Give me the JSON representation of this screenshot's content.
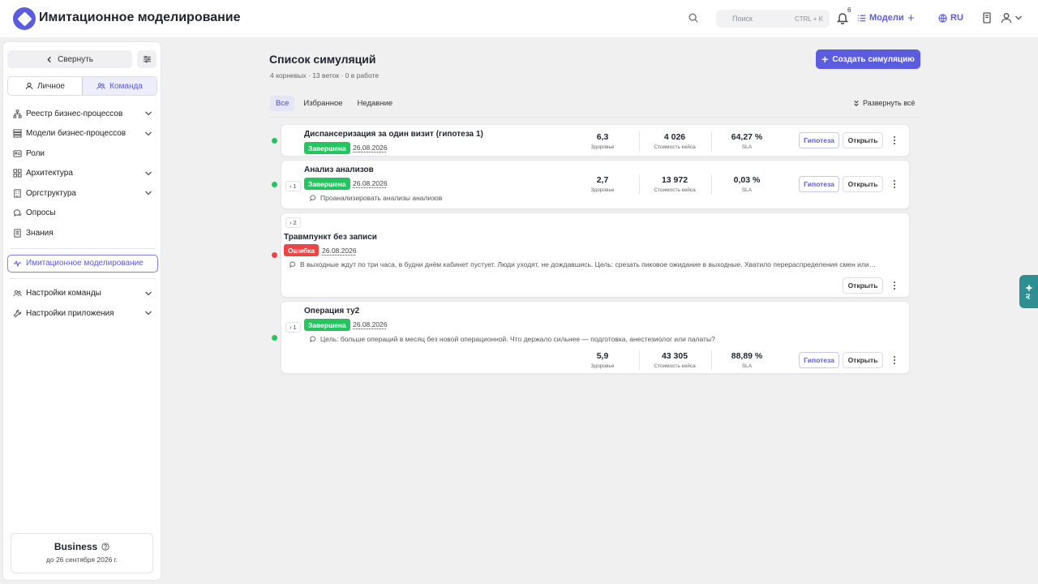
{
  "header": {
    "app_title": "Имитационное моделирование",
    "search_placeholder": "Поиск",
    "search_shortcut": "CTRL + K",
    "notifications_count": "6",
    "models_label": "Модели",
    "language": "RU"
  },
  "sidebar": {
    "collapse_label": "Свернуть",
    "scope_tabs": [
      {
        "label": "Личное",
        "icon": "user-icon",
        "active": false
      },
      {
        "label": "Команда",
        "icon": "team-icon",
        "active": true
      }
    ],
    "items": [
      {
        "label": "Реестр бизнес-процессов",
        "icon": "sitemap-icon",
        "expandable": true
      },
      {
        "label": "Модели бизнес-процессов",
        "icon": "layers-icon",
        "expandable": true
      },
      {
        "label": "Роли",
        "icon": "id-card-icon",
        "expandable": false
      },
      {
        "label": "Архитектура",
        "icon": "grid-icon",
        "expandable": true
      },
      {
        "label": "Оргструктура",
        "icon": "building-icon",
        "expandable": true
      },
      {
        "label": "Опросы",
        "icon": "chat-icon",
        "expandable": false
      },
      {
        "label": "Знания",
        "icon": "book-icon",
        "expandable": false
      }
    ],
    "active_item": {
      "label": "Имитационное моделирование",
      "icon": "activity-icon"
    },
    "settings_items": [
      {
        "label": "Настройки команды",
        "icon": "team-icon",
        "expandable": true
      },
      {
        "label": "Настройки приложения",
        "icon": "wrench-icon",
        "expandable": true
      }
    ],
    "plan": {
      "name": "Business",
      "until": "до 26 сентября 2026 г."
    }
  },
  "main": {
    "title": "Список симуляций",
    "subtitle": "4 корневых · 13 веток · 0 в работе",
    "create_label": "Создать симуляцию",
    "tabs": [
      {
        "label": "Все",
        "active": true
      },
      {
        "label": "Избранное",
        "active": false
      },
      {
        "label": "Недавние",
        "active": false
      }
    ],
    "expand_all_label": "Развернуть всё",
    "hypothesis_label": "Гипотеза",
    "open_label": "Открыть",
    "metric_labels": [
      "Здоровье",
      "Стоимость кейса",
      "SLA"
    ],
    "simulations": [
      {
        "title": "Диспансеризация за один визит (гипотеза 1)",
        "status": "Завершена",
        "status_color": "#22c55e",
        "date": "26.08.2026",
        "branches": "",
        "comment": "",
        "metrics": [
          "6,3",
          "4 026",
          "64,27 %"
        ]
      },
      {
        "title": "Анализ анализов",
        "status": "Завершена",
        "status_color": "#22c55e",
        "date": "26.08.2026",
        "branches": "1",
        "comment": "Проанализировать анализы анализов",
        "metrics": [
          "2,7",
          "13 972",
          "0,03 %"
        ]
      },
      {
        "title": "Травмпункт без записи",
        "status": "Ошибка",
        "status_color": "#ef4444",
        "date": "26.08.2026",
        "branches": "2",
        "comment": "В выходные ждут по три часа, в будни днём кабинет пустует. Люди уходят, не дождавшись. Цель: срезать пиковое ожидание в выходные. Хватило перераспределения смен или…",
        "metrics": []
      },
      {
        "title": "Операция ту2",
        "status": "Завершена",
        "status_color": "#22c55e",
        "date": "26.08.2026",
        "branches": "1",
        "comment": "Цель: больше операций в месяц без новой операционной. Что держало сильнее — подготовка, анестезиолог или палаты?",
        "metrics": [
          "5,9",
          "43 305",
          "88,89 %"
        ]
      }
    ]
  },
  "ai_tab_label": "AI",
  "colors": {
    "accent": "#5b5ce0",
    "success": "#22c55e",
    "error": "#ef4444",
    "ai_tab": "#2d8f92"
  }
}
